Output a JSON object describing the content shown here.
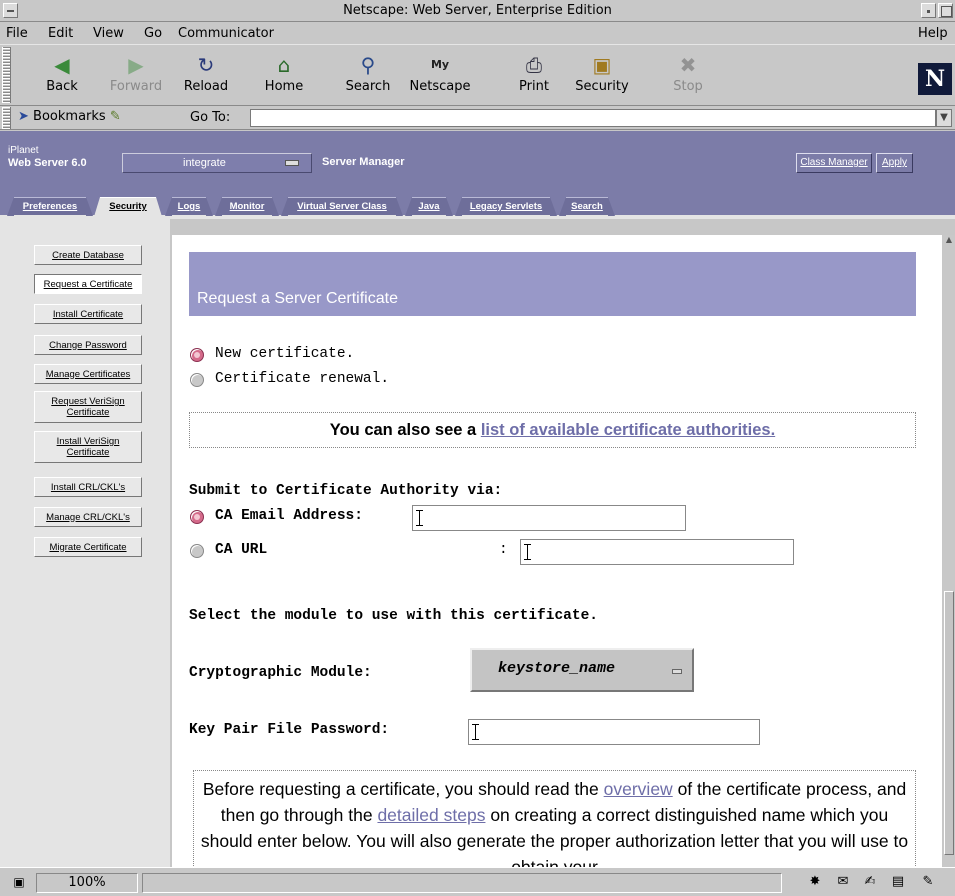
{
  "window": {
    "title": "Netscape: Web Server, Enterprise Edition"
  },
  "menubar": {
    "items": [
      "File",
      "Edit",
      "View",
      "Go",
      "Communicator"
    ],
    "help": "Help"
  },
  "toolbar": {
    "buttons": [
      {
        "label": "Back",
        "icon": "back-arrow-icon",
        "enabled": true
      },
      {
        "label": "Forward",
        "icon": "forward-arrow-icon",
        "enabled": false
      },
      {
        "label": "Reload",
        "icon": "reload-icon",
        "enabled": true
      },
      {
        "label": "Home",
        "icon": "home-icon",
        "enabled": true
      },
      {
        "label": "Search",
        "icon": "search-icon",
        "enabled": true
      },
      {
        "label": "Netscape",
        "icon": "my-netscape-icon",
        "enabled": true
      },
      {
        "label": "Print",
        "icon": "printer-icon",
        "enabled": true
      },
      {
        "label": "Security",
        "icon": "padlock-icon",
        "enabled": true
      },
      {
        "label": "Stop",
        "icon": "stop-icon",
        "enabled": false
      }
    ],
    "logo": "N"
  },
  "location": {
    "bookmarks_label": "Bookmarks",
    "goto_label": "Go To:",
    "url": ""
  },
  "banner": {
    "brand_line1": "iPlanet",
    "brand_line2": "Web Server 6.0",
    "server_select_value": "integrate",
    "server_manager_label": "Server Manager",
    "class_manager_label": "Class Manager",
    "apply_label": "Apply",
    "accent_color": "#7c7ca8"
  },
  "tabs": [
    {
      "label": "Preferences",
      "active": false
    },
    {
      "label": "Security",
      "active": true
    },
    {
      "label": "Logs",
      "active": false
    },
    {
      "label": "Monitor",
      "active": false
    },
    {
      "label": "Virtual Server Class",
      "active": false
    },
    {
      "label": "Java",
      "active": false
    },
    {
      "label": "Legacy Servlets",
      "active": false
    },
    {
      "label": "Search",
      "active": false
    }
  ],
  "leftnav": {
    "items": [
      {
        "label": "Create Database",
        "active": false
      },
      {
        "label": "Request a Certificate",
        "active": true
      },
      {
        "label": "Install Certificate",
        "active": false
      },
      {
        "label": "Change Password",
        "active": false
      },
      {
        "label": "Manage Certificates",
        "active": false
      },
      {
        "label": "Request VeriSign Certificate",
        "active": false
      },
      {
        "label": "Install VeriSign Certificate",
        "active": false
      },
      {
        "label": "Install CRL/CKL's",
        "active": false
      },
      {
        "label": "Manage CRL/CKL's",
        "active": false
      },
      {
        "label": "Migrate Certificate",
        "active": false
      }
    ]
  },
  "form": {
    "header": "Request a Server Certificate",
    "header_color": "#9898c8",
    "cert_type_options": [
      {
        "label": "New certificate.",
        "checked": true
      },
      {
        "label": "Certificate renewal.",
        "checked": false
      }
    ],
    "ca_list_prefix": "You can also see a",
    "ca_list_link": "list of available certificate authorities.",
    "submit_heading": "Submit to Certificate Authority via:",
    "ca_email_label": "CA Email Address:",
    "ca_email_checked": true,
    "ca_email_value": "",
    "ca_url_label": "CA URL",
    "ca_url_colon": ":",
    "ca_url_checked": false,
    "ca_url_value": "",
    "module_heading": "Select the module to use with this certificate.",
    "crypto_module_label": "Cryptographic Module:",
    "crypto_module_value": "keystore_name",
    "key_pair_password_label": "Key Pair File Password:",
    "key_pair_password_value": "",
    "info_parts": {
      "p1": "Before requesting a certificate, you should read the",
      "link1": "overview",
      "p2": "of the certificate process, and then go through the",
      "link2": "detailed steps",
      "p3": "on creating a correct distinguished name which you should enter below. You will also generate the proper authorization letter that you will use to obtain your"
    }
  },
  "status": {
    "zoom": "100%",
    "message": ""
  }
}
